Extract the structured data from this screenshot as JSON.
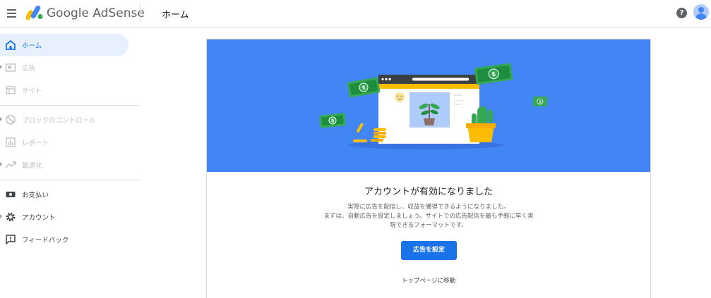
{
  "header": {
    "brand_google": "Google",
    "brand_product": "AdSense",
    "page_title": "ホーム",
    "help_symbol": "?"
  },
  "sidebar": {
    "items": [
      {
        "label": "ホーム",
        "icon": "home-icon",
        "state": "active"
      },
      {
        "label": "広告",
        "icon": "ads-icon",
        "state": "disabled"
      },
      {
        "label": "サイト",
        "icon": "sites-icon",
        "state": "disabled"
      },
      {
        "label": "ブロックのコントロール",
        "icon": "block-icon",
        "state": "disabled"
      },
      {
        "label": "レポート",
        "icon": "reports-icon",
        "state": "disabled"
      },
      {
        "label": "最適化",
        "icon": "optimization-icon",
        "state": "disabled"
      },
      {
        "label": "お支払い",
        "icon": "payments-icon",
        "state": "enabled"
      },
      {
        "label": "アカウント",
        "icon": "account-settings-icon",
        "state": "enabled"
      },
      {
        "label": "フィードバック",
        "icon": "feedback-icon",
        "state": "enabled"
      }
    ]
  },
  "main": {
    "title": "アカウントが有効になりました",
    "description_lines": [
      "実際に広告を配信し、収益を獲得できるようになりました。",
      "まずは、自動広告を設定しましょう。サイトでの広告配信を最も手軽に早く実",
      "現できるフォーマットです。"
    ],
    "cta_label": "広告を設定",
    "secondary_link": "トップページに移動"
  },
  "colors": {
    "accent": "#1a73e8",
    "hero_background": "#4285f4",
    "active_nav_background": "#e8f0fe"
  }
}
